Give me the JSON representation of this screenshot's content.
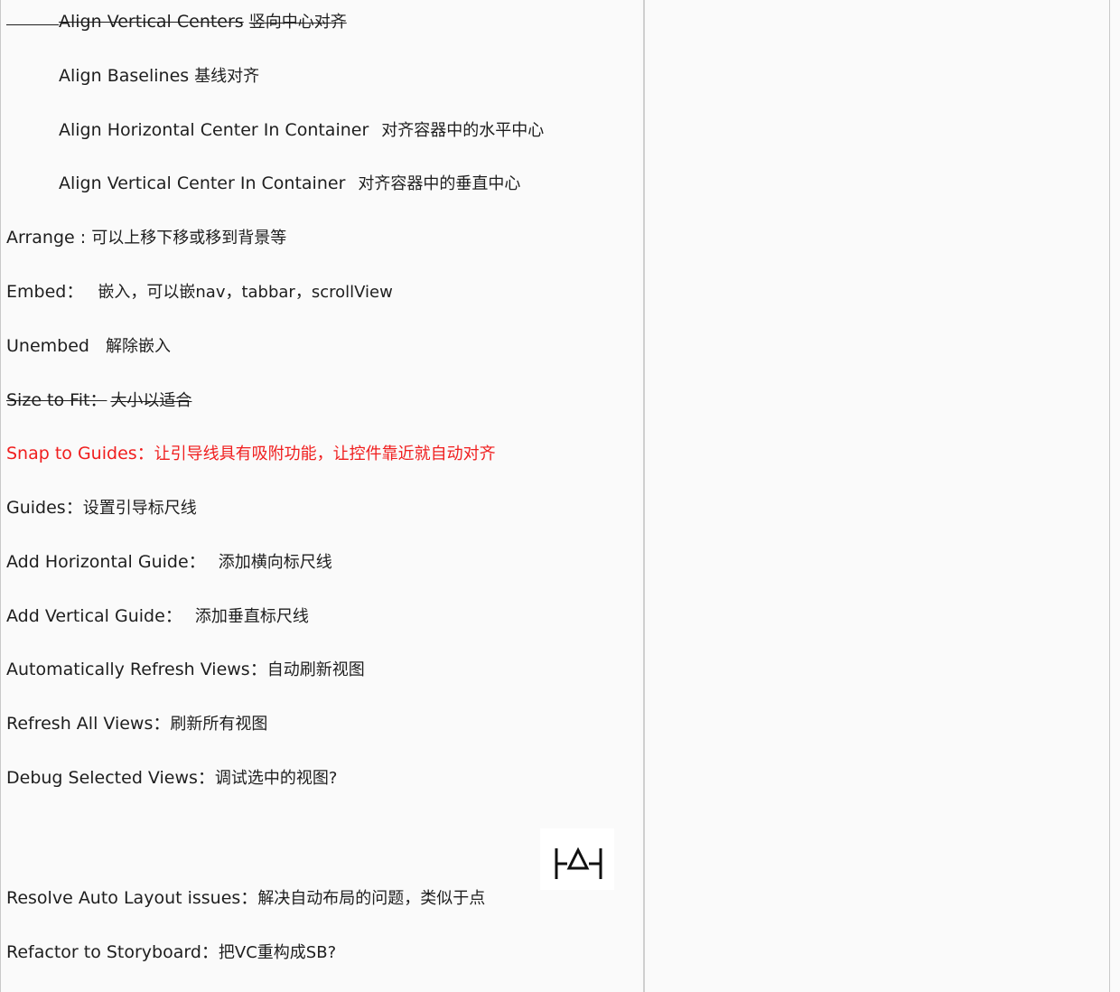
{
  "lines": [
    {
      "en": "Align Vertical Centers",
      "zh": "竖向中心对齐"
    },
    {
      "en": "Align Baselines",
      "zh": "基线对齐"
    },
    {
      "en": "Align Horizontal Center In Container",
      "zh": "对齐容器中的水平中心"
    },
    {
      "en": "Align Vertical Center In Container",
      "zh": "对齐容器中的垂直中心"
    },
    {
      "en": "Arrange : ",
      "zh": "可以上移下移或移到背景等"
    },
    {
      "en": "Embed： ",
      "zh": "嵌入，可以嵌nav，tabbar，scrollView"
    },
    {
      "en": "Unembed ",
      "zh": "解除嵌入"
    },
    {
      "en": "Size to Fit：",
      "zh": "大小以适合"
    },
    {
      "en": "Snap to Guides：",
      "zh": "让引导线具有吸附功能，让控件靠近就自动对齐"
    },
    {
      "en": "Guides：",
      "zh": "设置引导标尺线"
    },
    {
      "en": "Add Horizontal Guide： ",
      "zh": "添加横向标尺线"
    },
    {
      "en": "Add Vertical Guide： ",
      "zh": "添加垂直标尺线"
    },
    {
      "en": "Automatically Refresh Views：",
      "zh": "自动刷新视图"
    },
    {
      "en": "Refresh All Views：",
      "zh": "刷新所有视图"
    },
    {
      "en": "Debug Selected Views：",
      "zh": "调试选中的视图?"
    },
    {
      "en": "Resolve Auto Layout issues：",
      "zh": "解决自动布局的问题，类似于点"
    },
    {
      "en": "Refactor to Storyboard：",
      "zh": "把VC重构成SB?"
    }
  ],
  "icon": "resolve-auto-layout-issues-icon",
  "colors": {
    "text": "#1e1e1e",
    "highlight": "#f01e1e",
    "background": "#fafafa"
  }
}
